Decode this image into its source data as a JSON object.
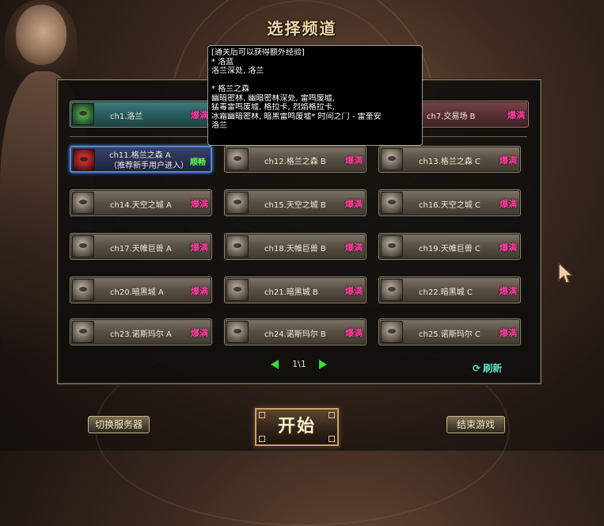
{
  "title": "选择频道",
  "tooltip": {
    "lines": [
      "[通关后可以获得额外经验]",
      "* 洛蓝",
      "洛兰深处, 洛兰",
      "",
      "* 格兰之森",
      "幽暗密林, 幽暗密林深处, 雷鸣废墟,",
      "猛毒雷鸣废墟, 格拉卡, 烈焰格拉卡,",
      "冰霜幽暗密林, 暗黑雷鸣废墟* 时间之门 - 雷奎安",
      "洛兰"
    ]
  },
  "top_channels": [
    {
      "name": "ch1.洛兰",
      "status": "爆满",
      "icon": "plant-icon"
    },
    {
      "name": "ch7.交易场 B",
      "status": "爆满",
      "icon": "trade-icon"
    }
  ],
  "channels": [
    {
      "name": "ch11.格兰之森 A",
      "sub": "（推荐新手用户进入）",
      "status": "顺畅",
      "icon": "red-flower-icon"
    },
    {
      "name": "ch12.格兰之森 B",
      "status": "爆满",
      "icon": "monster-icon"
    },
    {
      "name": "ch13.格兰之森 C",
      "status": "爆满",
      "icon": "monster-icon"
    },
    {
      "name": "ch14.天空之城 A",
      "status": "爆满",
      "icon": "monster-icon"
    },
    {
      "name": "ch15.天空之城 B",
      "status": "爆满",
      "icon": "monster-icon"
    },
    {
      "name": "ch16.天空之城 C",
      "status": "爆满",
      "icon": "monster-icon"
    },
    {
      "name": "ch17.天帷巨兽 A",
      "status": "爆满",
      "icon": "monster-icon"
    },
    {
      "name": "ch18.天帷巨兽 B",
      "status": "爆满",
      "icon": "monster-icon"
    },
    {
      "name": "ch19.天帷巨兽 C",
      "status": "爆满",
      "icon": "monster-icon"
    },
    {
      "name": "ch20.暗黑城 A",
      "status": "爆满",
      "icon": "monster-icon"
    },
    {
      "name": "ch21.暗黑城 B",
      "status": "爆满",
      "icon": "monster-icon"
    },
    {
      "name": "ch22.暗黑城 C",
      "status": "爆满",
      "icon": "monster-icon"
    },
    {
      "name": "ch23.诺斯玛尔 A",
      "status": "爆满",
      "icon": "monster-icon"
    },
    {
      "name": "ch24.诺斯玛尔 B",
      "status": "爆满",
      "icon": "monster-icon"
    },
    {
      "name": "ch25.诺斯玛尔 C",
      "status": "爆满",
      "icon": "monster-icon"
    }
  ],
  "pager": {
    "text": "1\\1"
  },
  "refresh_label": "刷新",
  "buttons": {
    "server": "切换服务器",
    "start": "开始",
    "exit": "结束游戏"
  },
  "colors": {
    "busy": "#ff3fa0",
    "smooth": "#5dff4a",
    "title": "#f0d9a6"
  }
}
